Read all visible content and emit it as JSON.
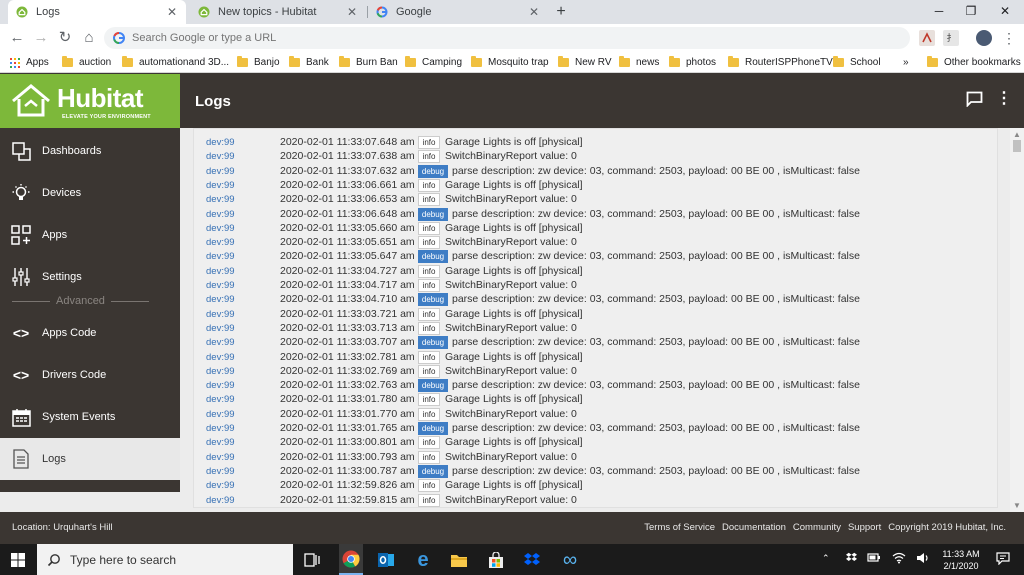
{
  "browser": {
    "tabs": [
      {
        "title": "Logs",
        "active": true
      },
      {
        "title": "New topics - Hubitat",
        "active": false
      },
      {
        "title": "Google",
        "active": false
      }
    ],
    "omnibox_placeholder": "Search Google or type a URL",
    "bookmarks": [
      {
        "label": "Apps",
        "icon": "apps-grid-icon"
      },
      {
        "label": "auction",
        "icon": "folder-icon"
      },
      {
        "label": "automationand 3D...",
        "icon": "folder-icon"
      },
      {
        "label": "Banjo",
        "icon": "folder-icon"
      },
      {
        "label": "Bank",
        "icon": "folder-icon"
      },
      {
        "label": "Burn Ban",
        "icon": "folder-icon"
      },
      {
        "label": "Camping",
        "icon": "folder-icon"
      },
      {
        "label": "Mosquito trap",
        "icon": "folder-icon"
      },
      {
        "label": "New RV",
        "icon": "folder-icon"
      },
      {
        "label": "news",
        "icon": "folder-icon"
      },
      {
        "label": "photos",
        "icon": "folder-icon"
      },
      {
        "label": "RouterISPPhoneTV",
        "icon": "folder-icon"
      },
      {
        "label": "School",
        "icon": "folder-icon"
      }
    ],
    "bookmarks_overflow": "»",
    "other_bookmarks": "Other bookmarks"
  },
  "hubitat": {
    "brand": "Hubitat",
    "tagline": "ELEVATE YOUR ENVIRONMENT",
    "page_title": "Logs",
    "nav": [
      {
        "label": "Dashboards",
        "icon": "dashboards-icon",
        "active": false
      },
      {
        "label": "Devices",
        "icon": "devices-bulb-icon",
        "active": false
      },
      {
        "label": "Apps",
        "icon": "apps-icon",
        "active": false
      },
      {
        "label": "Settings",
        "icon": "settings-sliders-icon",
        "active": false
      }
    ],
    "advanced_label": "Advanced",
    "advanced_nav": [
      {
        "label": "Apps Code",
        "icon": "code-icon",
        "active": false
      },
      {
        "label": "Drivers Code",
        "icon": "code-icon",
        "active": false
      },
      {
        "label": "System Events",
        "icon": "calendar-icon",
        "active": false
      },
      {
        "label": "Logs",
        "icon": "document-icon",
        "active": true
      }
    ],
    "footer": {
      "location": "Location: Urquhart's Hill",
      "links": [
        "Terms of Service",
        "Documentation",
        "Community",
        "Support",
        "Copyright 2019 Hubitat, Inc."
      ]
    }
  },
  "logs": [
    {
      "dev": "dev:99",
      "ts": "2020-02-01 11:33:07.648 am",
      "level": "info",
      "msg": "Garage Lights is off [physical]"
    },
    {
      "dev": "dev:99",
      "ts": "2020-02-01 11:33:07.638 am",
      "level": "info",
      "msg": "SwitchBinaryReport value: 0"
    },
    {
      "dev": "dev:99",
      "ts": "2020-02-01 11:33:07.632 am",
      "level": "debug",
      "msg": "parse description: zw device: 03, command: 2503, payload: 00 BE 00 , isMulticast: false"
    },
    {
      "dev": "dev:99",
      "ts": "2020-02-01 11:33:06.661 am",
      "level": "info",
      "msg": "Garage Lights is off [physical]"
    },
    {
      "dev": "dev:99",
      "ts": "2020-02-01 11:33:06.653 am",
      "level": "info",
      "msg": "SwitchBinaryReport value: 0"
    },
    {
      "dev": "dev:99",
      "ts": "2020-02-01 11:33:06.648 am",
      "level": "debug",
      "msg": "parse description: zw device: 03, command: 2503, payload: 00 BE 00 , isMulticast: false"
    },
    {
      "dev": "dev:99",
      "ts": "2020-02-01 11:33:05.660 am",
      "level": "info",
      "msg": "Garage Lights is off [physical]"
    },
    {
      "dev": "dev:99",
      "ts": "2020-02-01 11:33:05.651 am",
      "level": "info",
      "msg": "SwitchBinaryReport value: 0"
    },
    {
      "dev": "dev:99",
      "ts": "2020-02-01 11:33:05.647 am",
      "level": "debug",
      "msg": "parse description: zw device: 03, command: 2503, payload: 00 BE 00 , isMulticast: false"
    },
    {
      "dev": "dev:99",
      "ts": "2020-02-01 11:33:04.727 am",
      "level": "info",
      "msg": "Garage Lights is off [physical]"
    },
    {
      "dev": "dev:99",
      "ts": "2020-02-01 11:33:04.717 am",
      "level": "info",
      "msg": "SwitchBinaryReport value: 0"
    },
    {
      "dev": "dev:99",
      "ts": "2020-02-01 11:33:04.710 am",
      "level": "debug",
      "msg": "parse description: zw device: 03, command: 2503, payload: 00 BE 00 , isMulticast: false"
    },
    {
      "dev": "dev:99",
      "ts": "2020-02-01 11:33:03.721 am",
      "level": "info",
      "msg": "Garage Lights is off [physical]"
    },
    {
      "dev": "dev:99",
      "ts": "2020-02-01 11:33:03.713 am",
      "level": "info",
      "msg": "SwitchBinaryReport value: 0"
    },
    {
      "dev": "dev:99",
      "ts": "2020-02-01 11:33:03.707 am",
      "level": "debug",
      "msg": "parse description: zw device: 03, command: 2503, payload: 00 BE 00 , isMulticast: false"
    },
    {
      "dev": "dev:99",
      "ts": "2020-02-01 11:33:02.781 am",
      "level": "info",
      "msg": "Garage Lights is off [physical]"
    },
    {
      "dev": "dev:99",
      "ts": "2020-02-01 11:33:02.769 am",
      "level": "info",
      "msg": "SwitchBinaryReport value: 0"
    },
    {
      "dev": "dev:99",
      "ts": "2020-02-01 11:33:02.763 am",
      "level": "debug",
      "msg": "parse description: zw device: 03, command: 2503, payload: 00 BE 00 , isMulticast: false"
    },
    {
      "dev": "dev:99",
      "ts": "2020-02-01 11:33:01.780 am",
      "level": "info",
      "msg": "Garage Lights is off [physical]"
    },
    {
      "dev": "dev:99",
      "ts": "2020-02-01 11:33:01.770 am",
      "level": "info",
      "msg": "SwitchBinaryReport value: 0"
    },
    {
      "dev": "dev:99",
      "ts": "2020-02-01 11:33:01.765 am",
      "level": "debug",
      "msg": "parse description: zw device: 03, command: 2503, payload: 00 BE 00 , isMulticast: false"
    },
    {
      "dev": "dev:99",
      "ts": "2020-02-01 11:33:00.801 am",
      "level": "info",
      "msg": "Garage Lights is off [physical]"
    },
    {
      "dev": "dev:99",
      "ts": "2020-02-01 11:33:00.793 am",
      "level": "info",
      "msg": "SwitchBinaryReport value: 0"
    },
    {
      "dev": "dev:99",
      "ts": "2020-02-01 11:33:00.787 am",
      "level": "debug",
      "msg": "parse description: zw device: 03, command: 2503, payload: 00 BE 00 , isMulticast: false"
    },
    {
      "dev": "dev:99",
      "ts": "2020-02-01 11:32:59.826 am",
      "level": "info",
      "msg": "Garage Lights is off [physical]"
    },
    {
      "dev": "dev:99",
      "ts": "2020-02-01 11:32:59.815 am",
      "level": "info",
      "msg": "SwitchBinaryReport value: 0"
    }
  ],
  "taskbar": {
    "search_placeholder": "Type here to search",
    "clock_time": "11:33 AM",
    "clock_date": "2/1/2020",
    "pinned": [
      "task-view-icon",
      "chrome-icon",
      "outlook-icon",
      "edge-icon",
      "file-explorer-icon",
      "store-icon",
      "dropbox-icon",
      "infinity-app-icon"
    ]
  },
  "colors": {
    "hubitat_green": "#7db83a",
    "hubitat_dark": "#3b3632",
    "debug_badge": "#3e7dc5",
    "dev_link": "#3771b5"
  }
}
